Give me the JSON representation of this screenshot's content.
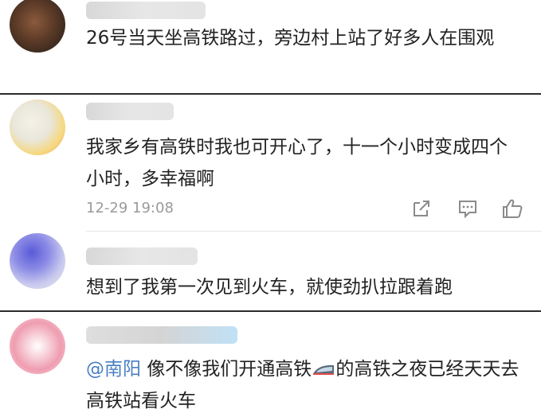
{
  "comments": [
    {
      "username": "",
      "text": "26号当天坐高铁路过，旁边村上站了好多人在围观"
    },
    {
      "username": "",
      "text": "我家乡有高铁时我也可开心了，十一个小时变成四个小时，多幸福啊",
      "timestamp": "12-29 19:08"
    },
    {
      "username": "",
      "text": "想到了我第一次见到火车，就使劲扒拉跟着跑"
    },
    {
      "username": "",
      "mention": "@南阳",
      "text_before_icon": " 像不像我们开通高铁",
      "icon": "train-emoji-icon",
      "text_after_icon": "的高铁之夜已经天天去高铁站看火车"
    }
  ],
  "actions": [
    "share-icon",
    "comment-icon",
    "like-icon"
  ]
}
